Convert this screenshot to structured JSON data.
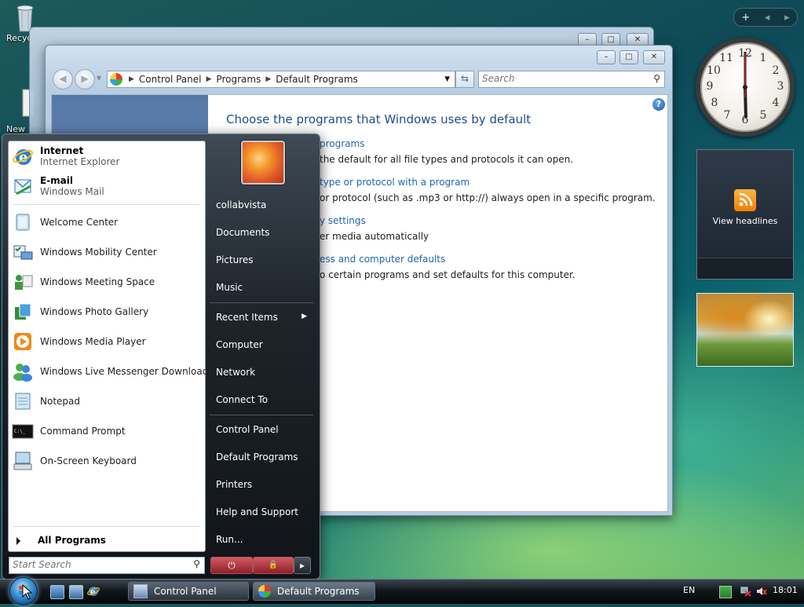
{
  "desktop": {
    "icons": [
      {
        "label": "Recycle Bin"
      },
      {
        "label": "New"
      }
    ]
  },
  "sidebar": {
    "controls": [
      "+",
      "◂",
      "▸"
    ],
    "clock": {
      "numbers": [
        "12",
        "1",
        "2",
        "3",
        "4",
        "5",
        "6",
        "7",
        "8",
        "9",
        "10",
        "11"
      ],
      "time": "18:01"
    },
    "feed_label": "View headlines"
  },
  "window": {
    "title_buttons": [
      "–",
      "□",
      "✕"
    ],
    "breadcrumb": [
      "Control Panel",
      "Programs",
      "Default Programs"
    ],
    "search_placeholder": "Search",
    "heading": "Choose the programs that Windows uses by default",
    "tasks": [
      {
        "link": "programs",
        "desc": "the default for all file types and protocols it can open."
      },
      {
        "link": "type or protocol with a program",
        "desc": "or protocol (such as .mp3 or http://) always open in a specific program."
      },
      {
        "link": "y settings",
        "desc": "er media automatically"
      },
      {
        "link": "ess and computer defaults",
        "desc": "o certain programs and set defaults for this computer."
      }
    ]
  },
  "start_menu": {
    "pinned": [
      {
        "name": "Internet",
        "sub": "Internet Explorer"
      },
      {
        "name": "E-mail",
        "sub": "Windows Mail"
      }
    ],
    "recent": [
      "Welcome Center",
      "Windows Mobility Center",
      "Windows Meeting Space",
      "Windows Photo Gallery",
      "Windows Media Player",
      "Windows Live Messenger Download",
      "Notepad",
      "Command Prompt",
      "On-Screen Keyboard"
    ],
    "all_programs": "All Programs",
    "search_placeholder": "Start Search",
    "right": {
      "user": "collabvista",
      "group1": [
        "Documents",
        "Pictures",
        "Music"
      ],
      "group2": [
        "Recent Items",
        "Computer",
        "Network",
        "Connect To"
      ],
      "group3": [
        "Control Panel",
        "Default Programs",
        "Printers",
        "Help and Support",
        "Run..."
      ]
    },
    "power_buttons": {
      "power": "⏻",
      "lock": "🔒",
      "arrow": "▸"
    }
  },
  "taskbar": {
    "tasks": [
      "Control Panel",
      "Default Programs"
    ],
    "language": "EN",
    "clock": "18:01"
  },
  "colors": {
    "link": "#1f66b0",
    "heading": "#1d4e8f",
    "accent_red": "#b0505a"
  }
}
